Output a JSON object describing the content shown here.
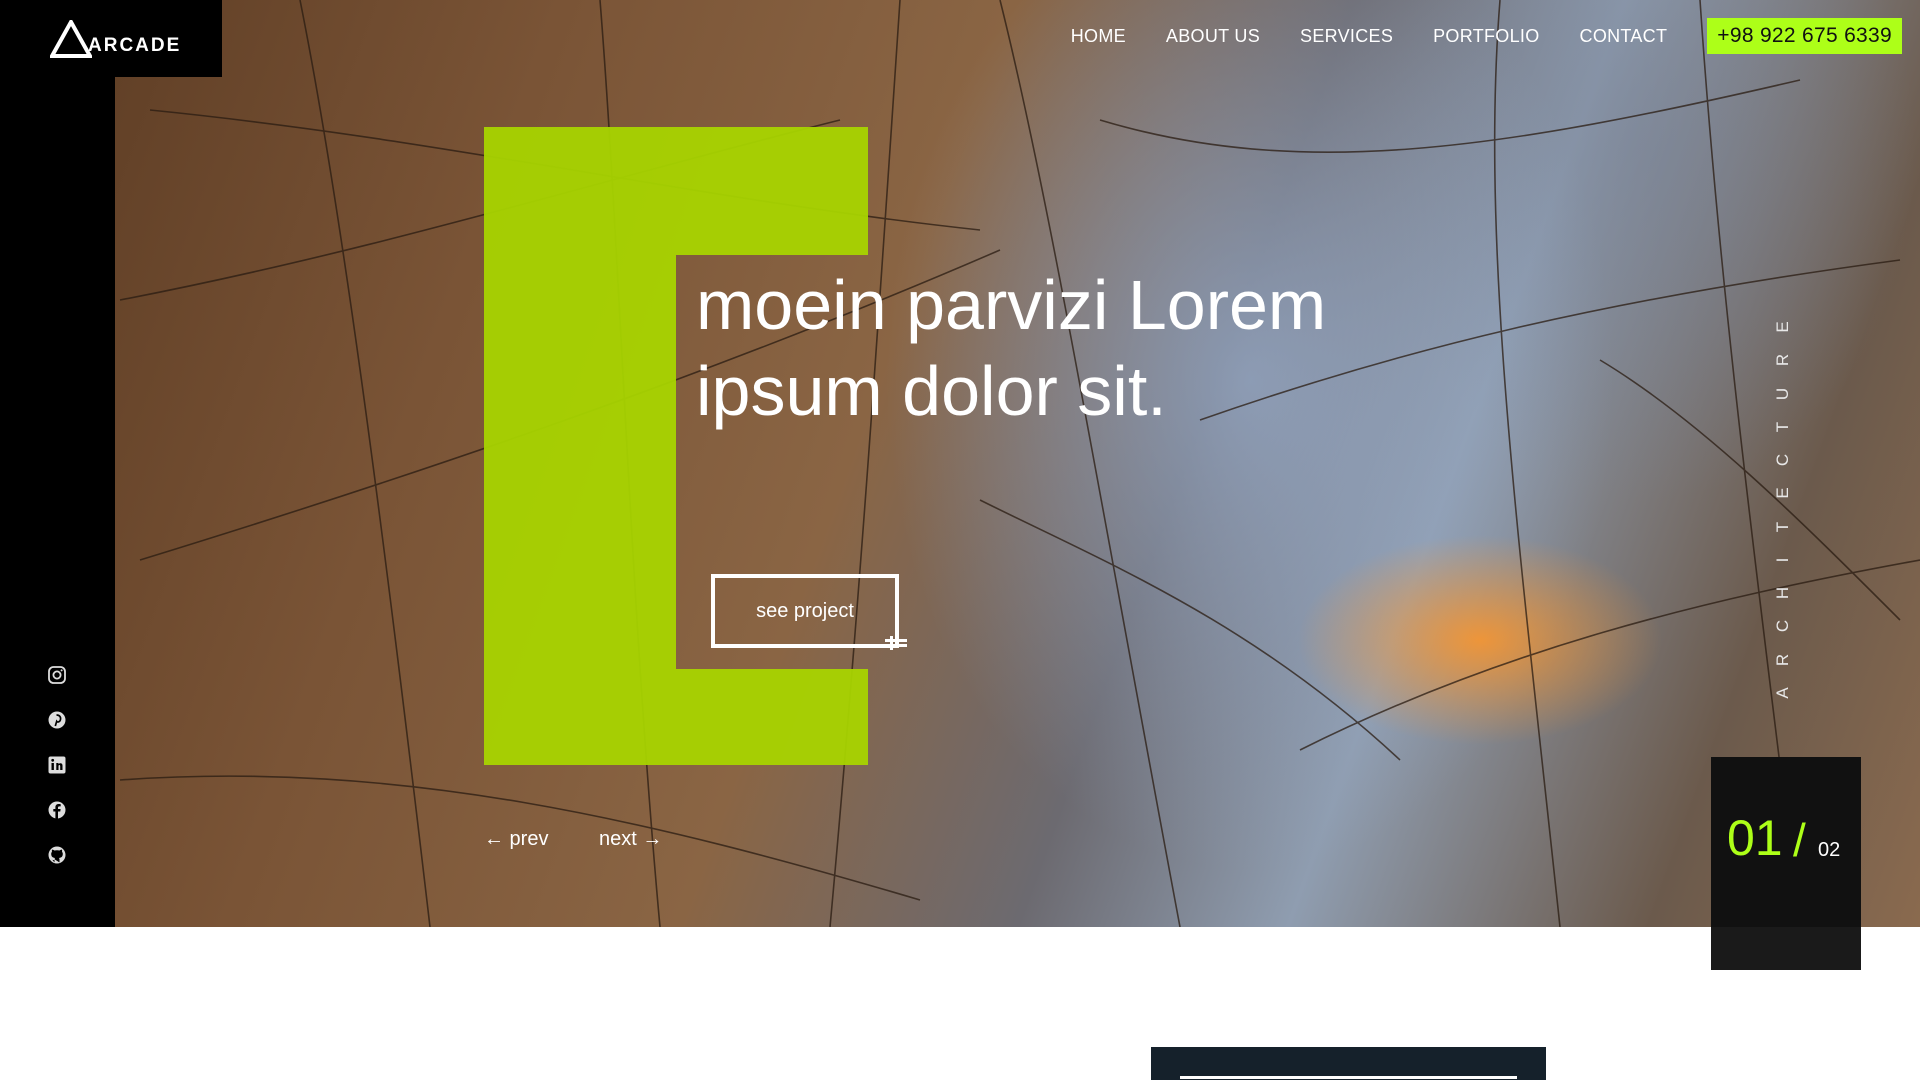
{
  "brand": {
    "name": "ARCADE"
  },
  "nav": {
    "items": [
      "HOME",
      "ABOUT US",
      "SERVICES",
      "PORTFOLIO",
      "CONTACT"
    ],
    "phone": "+98 922 675 6339"
  },
  "hero": {
    "headline_line1": "moein parvizi Lorem",
    "headline_line2": "ipsum dolor sit.",
    "cta": "see project",
    "prev": "← prev",
    "next": "next →",
    "category_letters": [
      "A",
      "R",
      "C",
      "H",
      "I",
      "T",
      "E",
      "C",
      "T",
      "U",
      "R",
      "E"
    ],
    "counter_current": "01",
    "counter_separator": "/",
    "counter_total": "02"
  },
  "social": [
    "instagram-icon",
    "pinterest-icon",
    "linkedin-icon",
    "facebook-icon",
    "github-icon"
  ],
  "colors": {
    "accent": "#adff18",
    "dark": "#000000",
    "card": "#15212b"
  }
}
